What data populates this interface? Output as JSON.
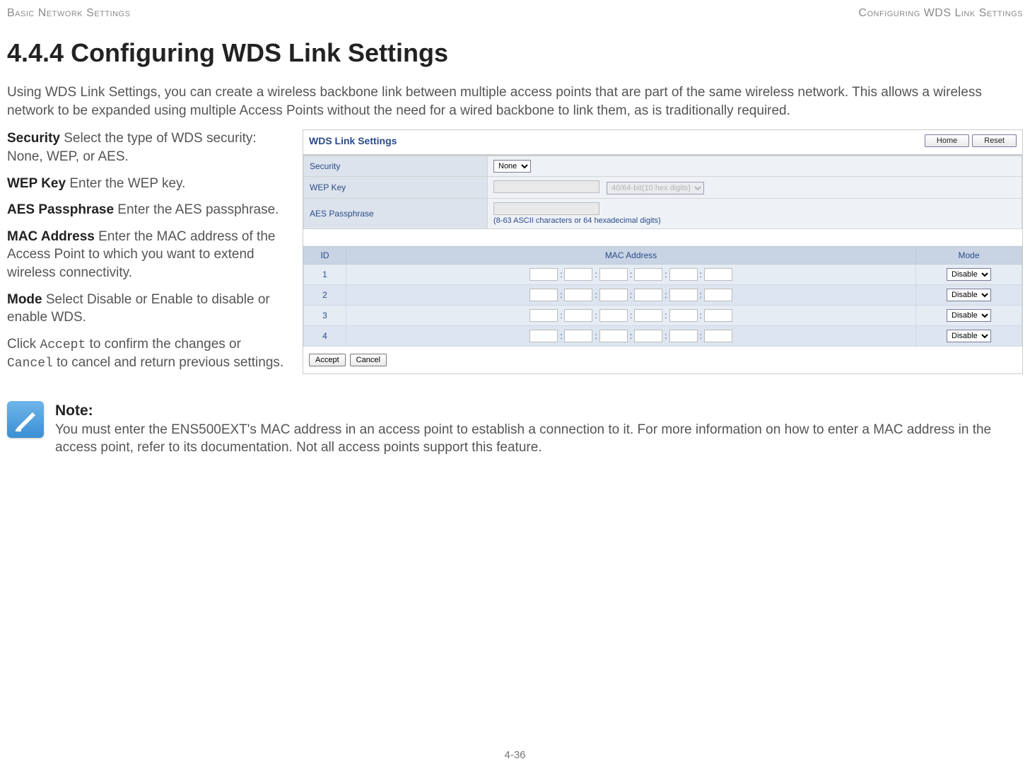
{
  "header": {
    "left": "Basic Network Settings",
    "right": "Configuring WDS Link Settings"
  },
  "section": {
    "number_title": "4.4.4 Configuring WDS Link Settings",
    "intro": "Using WDS Link Settings, you can create a wireless backbone link between multiple access points that are part of the same wireless network. This allows a wireless network to be expanded using multiple Access Points without the need for a wired backbone to link them, as is traditionally required."
  },
  "definitions": {
    "security": {
      "term": "Security",
      "text": "  Select the type of WDS security: None, WEP, or AES."
    },
    "wep": {
      "term": "WEP Key",
      "text": "  Enter the WEP key."
    },
    "aes": {
      "term": "AES Passphrase",
      "text": "  Enter the AES passphrase."
    },
    "mac": {
      "term": "MAC Address",
      "text": "  Enter the MAC address of the Access Point to which you want to extend wireless connectivity."
    },
    "mode": {
      "term": "Mode",
      "text": "  Select Disable or Enable to disable or enable WDS."
    },
    "click_pre": "Click ",
    "accept_mono": "Accept",
    "click_mid": " to confirm the changes or ",
    "cancel_mono": "Cancel",
    "click_post": " to cancel and return previous settings."
  },
  "panel": {
    "title": "WDS Link Settings",
    "home_btn": "Home",
    "reset_btn": "Reset",
    "rows": {
      "security_label": "Security",
      "security_value": "None",
      "wep_label": "WEP Key",
      "wep_dropdown": "40/64-bit(10 hex digits)",
      "aes_label": "AES Passphrase",
      "aes_hint": "(8-63 ASCII characters or 64 hexadecimal digits)"
    },
    "mac_headers": {
      "id": "ID",
      "mac": "MAC Address",
      "mode": "Mode"
    },
    "mac_rows": [
      {
        "id": "1",
        "mode": "Disable"
      },
      {
        "id": "2",
        "mode": "Disable"
      },
      {
        "id": "3",
        "mode": "Disable"
      },
      {
        "id": "4",
        "mode": "Disable"
      }
    ],
    "accept_btn": "Accept",
    "cancel_btn": "Cancel"
  },
  "note": {
    "heading": "Note:",
    "body": "You must enter the ENS500EXT's MAC address in an access point to establish a connection to it. For more information on how to enter a MAC address in the access point, refer to its documentation. Not all access points support this feature."
  },
  "page_number": "4-36"
}
